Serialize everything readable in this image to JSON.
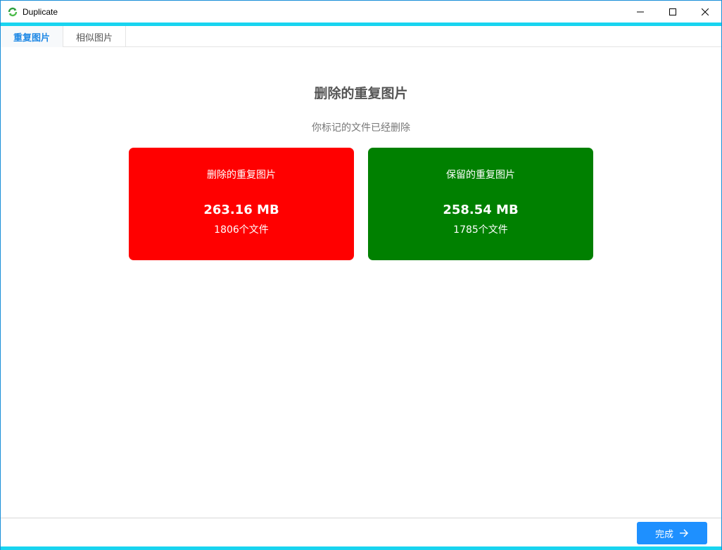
{
  "window": {
    "title": "Duplicate",
    "icon": "app-refresh-icon",
    "controls": [
      "minimize-icon",
      "maximize-icon",
      "close-icon"
    ]
  },
  "tabs": [
    {
      "label": "重复图片",
      "active": true
    },
    {
      "label": "相似图片",
      "active": false
    }
  ],
  "main": {
    "heading": "删除的重复图片",
    "subheading": "你标记的文件已经删除",
    "cards": [
      {
        "title": "删除的重复图片",
        "size": "263.16 MB",
        "count": "1806个文件",
        "color": "#ff0000"
      },
      {
        "title": "保留的重复图片",
        "size": "258.54 MB",
        "count": "1785个文件",
        "color": "#008000"
      }
    ]
  },
  "footer": {
    "done_label": "完成",
    "done_icon": "arrow-right-icon",
    "button_color": "#1e90ff"
  },
  "colors": {
    "accent_bar": "#18d4f0",
    "tab_active": "#1e88e5"
  }
}
